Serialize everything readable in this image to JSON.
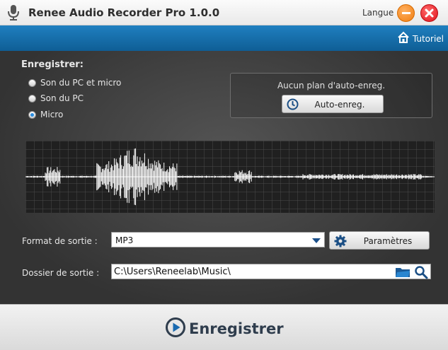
{
  "window": {
    "title": "Renee Audio Recorder Pro 1.0.0",
    "language_label": "Langue"
  },
  "toolbar": {
    "tutorial_label": "Tutoriel"
  },
  "record": {
    "heading": "Enregistrer:",
    "sources": [
      {
        "label": "Son du PC et micro",
        "selected": false
      },
      {
        "label": "Son du PC",
        "selected": false
      },
      {
        "label": "Micro",
        "selected": true
      }
    ]
  },
  "schedule": {
    "status_text": "Aucun plan d'auto-enreg.",
    "button_label": "Auto-enreg."
  },
  "output": {
    "format_label": "Format de sortie :",
    "format_value": "MP3",
    "settings_label": "Paramètres",
    "folder_label": "Dossier de sortie :",
    "folder_value": "C:\\Users\\Reneelab\\Music\\"
  },
  "footer": {
    "record_button_label": "Enregistrer"
  },
  "colors": {
    "accent_blue": "#1a72b4",
    "minimize": "#f39019",
    "close": "#e8141c",
    "background": "#3a3a3a"
  },
  "icons": [
    "microphone-icon",
    "minimize-icon",
    "close-icon",
    "home-icon",
    "clock-icon",
    "gear-icon",
    "folder-icon",
    "search-icon",
    "play-icon"
  ]
}
